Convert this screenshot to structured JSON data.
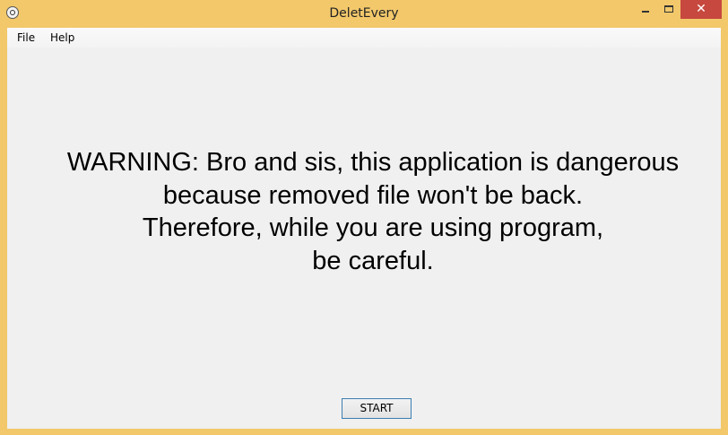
{
  "window": {
    "title": "DeletEvery",
    "close_glyph": "✕",
    "accent_color": "#f2c86b",
    "close_color": "#c7483e"
  },
  "menu": {
    "items": [
      {
        "label": "File"
      },
      {
        "label": "Help"
      }
    ]
  },
  "main": {
    "warning_lines": [
      "WARNING:  Bro and sis, this application is dangerous",
      "because removed file won't be back.",
      "Therefore, while you are using program,",
      "be careful."
    ],
    "start_label": "START"
  },
  "icons": {
    "app": "app-icon",
    "minimize": "minimize-icon",
    "maximize": "maximize-icon",
    "close": "close-icon"
  }
}
